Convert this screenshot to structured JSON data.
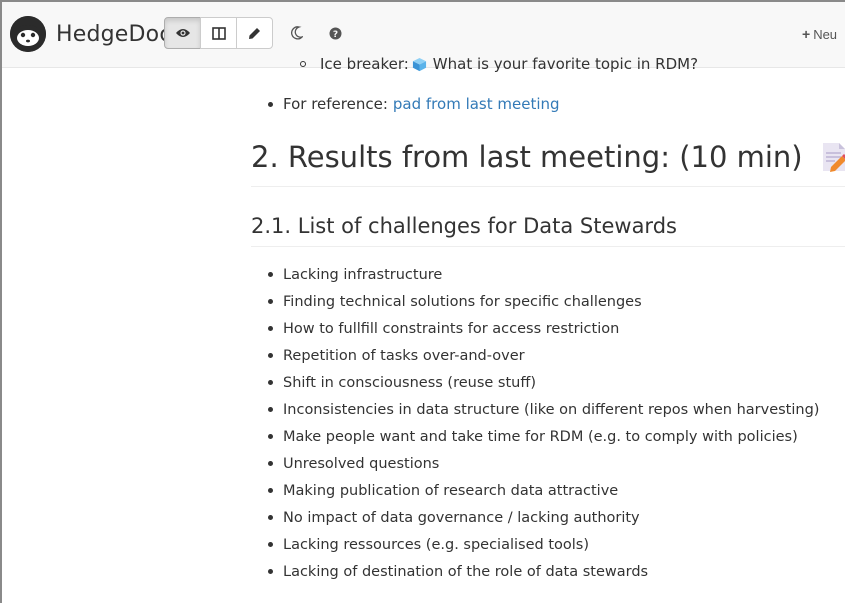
{
  "navbar": {
    "brand_name": "HedgeDoc",
    "logo_icon": "hedgehog-logo-icon",
    "view_modes": [
      {
        "icon": "eye-icon",
        "active": true
      },
      {
        "icon": "columns-icon",
        "active": false
      },
      {
        "icon": "pencil-icon",
        "active": false
      }
    ],
    "night_mode_icon": "moon-icon",
    "help_icon": "question-circle-icon",
    "new_label": "Neu",
    "new_icon": "plus-icon"
  },
  "document": {
    "sub_item_prefix": "Ice breaker:",
    "sub_item_icon": "ice-cube-icon",
    "sub_item_text": "What is your favorite topic in RDM?",
    "reference_prefix": "For reference:",
    "reference_link": "pad from last meeting",
    "section_heading": "2. Results from last meeting: (10 min)",
    "section_icon": "memo-icon",
    "subsection_heading": "2.1. List of challenges for Data Stewards",
    "challenges": [
      "Lacking infrastructure",
      "Finding technical solutions for specific challenges",
      "How to fullfill constraints for access restriction",
      "Repetition of tasks over-and-over",
      "Shift in consciousness (reuse stuff)",
      "Inconsistencies in data structure (like on different repos when harvesting)",
      "Make people want and take time for RDM (e.g. to comply with policies)",
      "Unresolved questions",
      "Making publication of research data attractive",
      "No impact of data governance / lacking authority",
      "Lacking ressources (e.g. specialised tools)",
      "Lacking of destination of the role of data stewards"
    ]
  },
  "colors": {
    "link": "#337ab7",
    "text": "#333333",
    "navbar_bg": "#f8f8f8"
  }
}
